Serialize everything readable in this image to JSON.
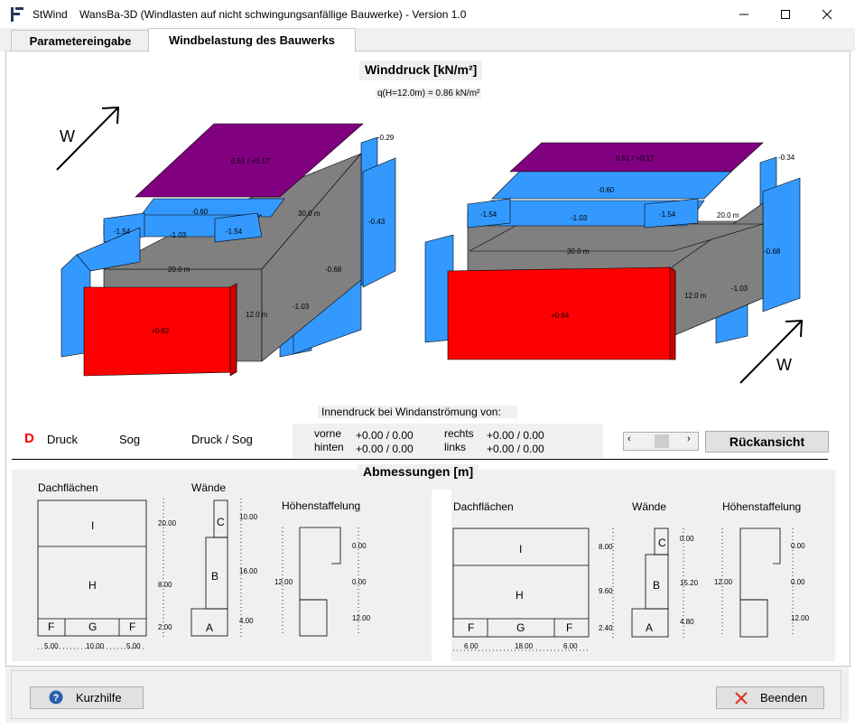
{
  "window": {
    "app_name": "StWind",
    "title": "WansBa-3D (Windlasten auf nicht schwingungsanfällige Bauwerke) - Version 1.0"
  },
  "tabs": [
    {
      "label": "Parametereingabe",
      "active": false
    },
    {
      "label": "Windbelastung des Bauwerks",
      "active": true
    }
  ],
  "winddruck": {
    "title": "Winddruck [kN/m²]",
    "formula": "q(H=12.0m) = 0.86 kN/m²"
  },
  "left_view": {
    "wind_label": "W",
    "roof_top": "0.51 /  +0.17",
    "roof_top_right": "-0.29",
    "roof_mid": "-0.60",
    "roof_left": "-1.54",
    "roof_center": "-1.03",
    "roof_right": "-1.54",
    "dim_depth": "30.0 m",
    "dim_width": "20.0 m",
    "dim_height": "12.0  m",
    "right_wall_upper": "-0.43",
    "right_wall_lower": "-0.68",
    "right_wall_front": "-1.03",
    "front_wall": "+0.62"
  },
  "right_view": {
    "wind_label": "W",
    "roof_top": "0.51 /  +0.17",
    "roof_top_right": "-0.34",
    "roof_mid": "-0.60",
    "roof_left": "-1.54",
    "roof_center": "-1.03",
    "roof_right": "-1.54",
    "dim_depth": "20.0 m",
    "dim_width": "30.0 m",
    "dim_height": "12.0  m",
    "right_wall_upper": "-0.68",
    "right_wall_front": "-1.03",
    "front_wall": "+0.64"
  },
  "innendruck": {
    "title": "Innendruck bei Windanströmung von:",
    "vorne_label": "vorne",
    "vorne_value": "+0.00 / 0.00",
    "hinten_label": "hinten",
    "hinten_value": "+0.00 / 0.00",
    "rechts_label": "rechts",
    "rechts_value": "+0.00 / 0.00",
    "links_label": "links",
    "links_value": "+0.00 / 0.00"
  },
  "legend": {
    "marker": "D",
    "druck": "Druck",
    "sog": "Sog",
    "druck_sog": "Druck / Sog"
  },
  "rueckansicht_label": "Rückansicht",
  "abmessungen": {
    "title": "Abmessungen [m]",
    "left": {
      "dach_title": "Dachflächen",
      "zone_i": "I",
      "zone_h": "H",
      "zone_f1": "F",
      "zone_g": "G",
      "zone_f2": "F",
      "dim_i": "20.00",
      "dim_h": "8.00",
      "dim_f": "2.00",
      "dim_bottom_1": "5.00",
      "dim_bottom_2": "10.00",
      "dim_bottom_3": "5.00",
      "waende_title": "Wände",
      "zone_a": "A",
      "zone_b": "B",
      "zone_c": "C",
      "dim_c": "10.00",
      "dim_b": "16.00",
      "dim_a": "4.00",
      "hoehen_title": "Höhenstaffelung",
      "hoehen_total": "12.00",
      "hoehen_1": "0.00",
      "hoehen_2": "0.00",
      "hoehen_3": "12.00"
    },
    "right": {
      "dach_title": "Dachflächen",
      "zone_i": "I",
      "zone_h": "H",
      "zone_f1": "F",
      "zone_g": "G",
      "zone_f2": "F",
      "dim_i": "8.00",
      "dim_h": "9.60",
      "dim_f": "2.40",
      "dim_bottom_1": "6.00",
      "dim_bottom_2": "18.00",
      "dim_bottom_3": "6.00",
      "waende_title": "Wände",
      "zone_a": "A",
      "zone_b": "B",
      "zone_c": "C",
      "dim_c": "0.00",
      "dim_b": "15.20",
      "dim_a": "4.80",
      "hoehen_title": "Höhenstaffelung",
      "hoehen_total": "12.00",
      "hoehen_1": "0.00",
      "hoehen_2": "0.00",
      "hoehen_3": "12.00"
    }
  },
  "footer": {
    "help_label": "Kurzhilfe",
    "exit_label": "Beenden"
  },
  "colors": {
    "druck": "#ff0000",
    "sog": "#3399ff",
    "druck_sog": "#800080",
    "body": "#808080"
  }
}
